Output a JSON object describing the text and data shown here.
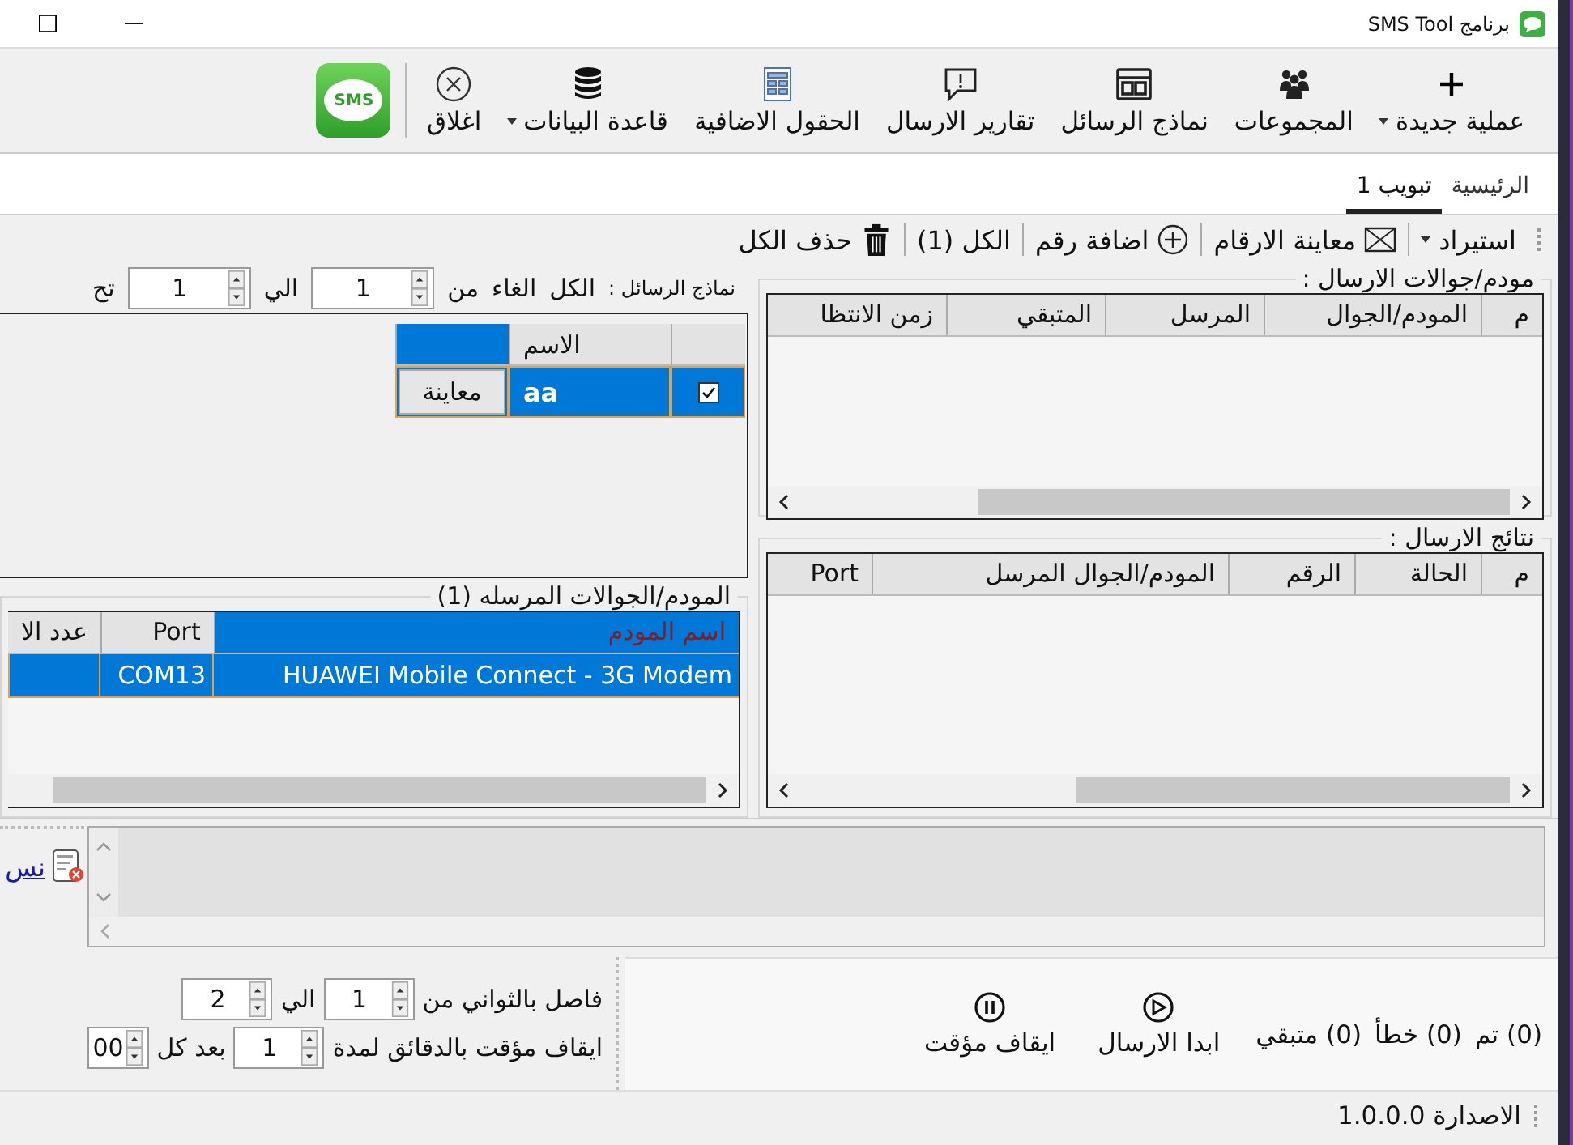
{
  "window": {
    "title": "برنامج SMS Tool"
  },
  "toolbar": [
    {
      "label": "عملية جديدة",
      "kind": "new",
      "dropdown": true
    },
    {
      "label": "المجموعات",
      "kind": "groups",
      "dropdown": false
    },
    {
      "label": "نماذج الرسائل",
      "kind": "templates",
      "dropdown": false
    },
    {
      "label": "تقارير الارسال",
      "kind": "reports",
      "dropdown": false
    },
    {
      "label": "الحقول الاضافية",
      "kind": "fields",
      "dropdown": false
    },
    {
      "label": "قاعدة البيانات",
      "kind": "database",
      "dropdown": true
    },
    {
      "label": "اغلاق",
      "kind": "close",
      "dropdown": false
    }
  ],
  "logo": {
    "text": "SMS"
  },
  "tabs": [
    {
      "label": "الرئيسية",
      "selected": false
    },
    {
      "label": "تبويب 1",
      "selected": true
    }
  ],
  "actions": [
    {
      "label": "استيراد",
      "kind": "menu"
    },
    {
      "label": "معاينة الارقام",
      "kind": "envelope"
    },
    {
      "label": "اضافة رقم",
      "kind": "plus"
    },
    {
      "label": "الكل (1)",
      "kind": "plain"
    },
    {
      "label": "حذف الكل",
      "kind": "trash"
    }
  ],
  "templates": {
    "label": "نماذج الرسائل :",
    "all": "الكل",
    "cancel": "الغاء",
    "from_label": "من",
    "from": "1",
    "to_label": "الي",
    "to": "1",
    "cut_label": "تح",
    "name_column": {
      "label": "الاسم",
      "selected": false
    },
    "preview_column": {
      "selected": true
    },
    "rows": [
      {
        "checked": true,
        "name": "aa",
        "preview": "معاينة",
        "selected": true
      }
    ]
  },
  "sending_modems": {
    "title": "مودم/جوالات الارسال :",
    "columns": [
      "م",
      "المودم/الجوال",
      "المرسل",
      "المتبقي",
      "زمن الانتظا"
    ]
  },
  "results": {
    "title": "نتائج الارسال :",
    "columns": [
      "م",
      "الحالة",
      "الرقم",
      "المودم/الجوال المرسل",
      "Port"
    ]
  },
  "sent_modems": {
    "title": "المودم/الجوالات المرسله (1)",
    "columns": [
      {
        "label": "اسم المودم",
        "selected": true
      },
      {
        "label": "Port",
        "selected": false
      },
      {
        "label": "عدد الا",
        "selected": false
      }
    ],
    "rows": [
      {
        "name": "HUAWEI Mobile Connect - 3G Modem",
        "port": "COM13",
        "selected": true
      }
    ]
  },
  "log": {
    "link": "نس"
  },
  "counters": [
    "(0) تم",
    "(0) خطأ",
    "(0) متبقي"
  ],
  "send_buttons": [
    {
      "label": "ابدا الارسال",
      "kind": "start"
    },
    {
      "label": "ايقاف مؤقت",
      "kind": "pause"
    }
  ],
  "interval": {
    "label": "فاصل بالثواني من",
    "from": "1",
    "to_label": "الي",
    "to": "2"
  },
  "pause_setting": {
    "label": "ايقاف مؤقت بالدقائق لمدة",
    "minutes": "1",
    "every_label": "بعد كل",
    "every": "00"
  },
  "status_bar": {
    "version": "الاصدارة 1.0.0.0"
  }
}
